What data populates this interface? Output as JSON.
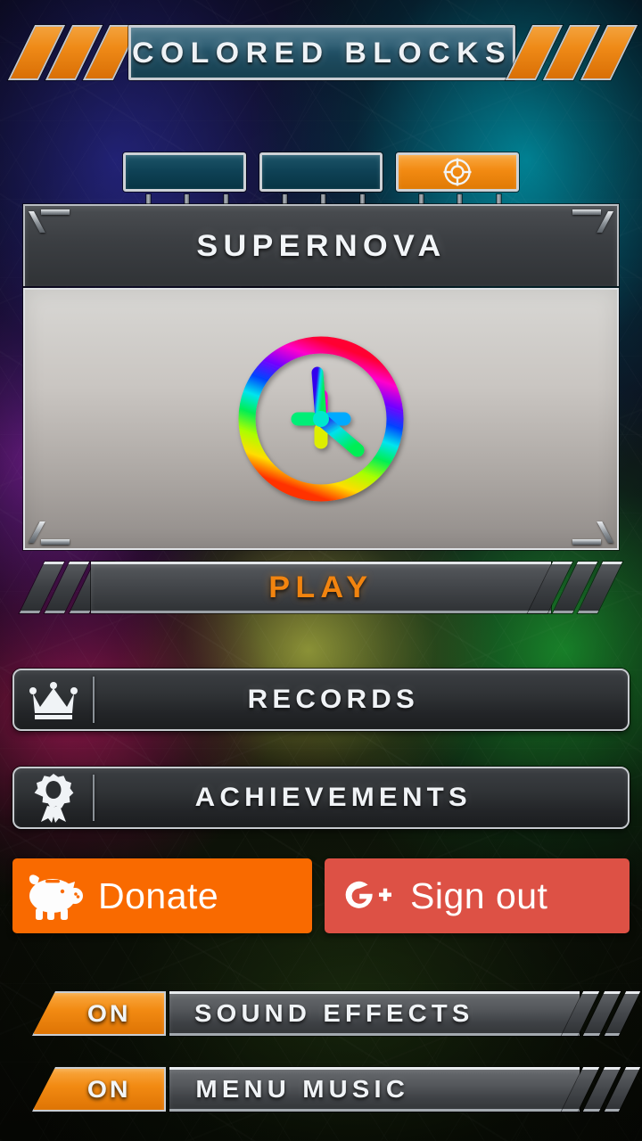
{
  "app": {
    "title": "COLORED BLOCKS"
  },
  "tabs": [
    {
      "name": "tab-one",
      "label": "",
      "icon": "",
      "active": false
    },
    {
      "name": "tab-two",
      "label": "",
      "icon": "",
      "active": false
    },
    {
      "name": "tab-three",
      "label": "",
      "icon": "target-crosshair-icon",
      "active": true
    }
  ],
  "mode_panel": {
    "title": "SUPERNOVA",
    "icon": "rainbow-clock-icon"
  },
  "play": {
    "label": "PLAY"
  },
  "menu_buttons": [
    {
      "name": "records",
      "label": "RECORDS",
      "icon": "crown-icon"
    },
    {
      "name": "achievements",
      "label": "ACHIEVEMENTS",
      "icon": "award-ribbon-icon"
    }
  ],
  "social": {
    "donate": {
      "label": "Donate",
      "icon": "piggy-bank-icon"
    },
    "signout": {
      "label": "Sign out",
      "icon": "google-plus-icon"
    }
  },
  "toggles": [
    {
      "name": "sound-effects",
      "state": "ON",
      "label": "SOUND EFFECTS"
    },
    {
      "name": "menu-music",
      "state": "ON",
      "label": "MENU MUSIC"
    }
  ],
  "colors": {
    "accent_orange": "#f2840f",
    "tab_active": "#f28a12",
    "tab_inactive": "#0f4256",
    "donate_bg": "#f96a00",
    "signout_bg": "#dd5145",
    "panel_head": "#3b3e42",
    "panel_body": "#c9c5c1",
    "title_plate": "#1d4a5e"
  }
}
